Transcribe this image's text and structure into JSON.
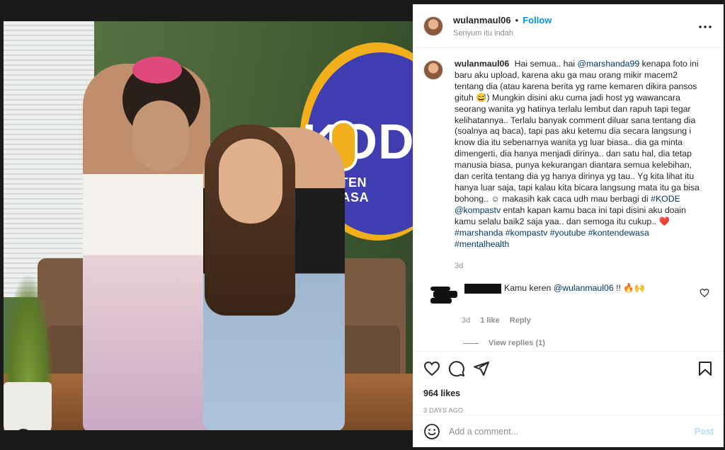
{
  "photo": {
    "logo_text": "KODE",
    "logo_subtext": "KONTEN DEWASA"
  },
  "header": {
    "username": "wulanmaul06",
    "separator": "•",
    "follow_label": "Follow",
    "location": "Senyum itu indah",
    "more_icon": "more-icon"
  },
  "caption": {
    "username": "wulanmaul06",
    "segments": [
      {
        "t": "text",
        "v": "Hai semua.. hai "
      },
      {
        "t": "mention",
        "v": "@marshanda99"
      },
      {
        "t": "text",
        "v": " kenapa foto ini baru aku upload, karena aku ga mau orang mikir macem2 tentang dia (atau karena berita yg rame kemaren dikira pansos gituh 😅) Mungkin disini aku cuma jadi host yg wawancara seorang wanita yg hatinya terlalu lembut dan rapuh tapi tegar kelihatannya.. Terlalu banyak comment diluar sana tentang dia (soalnya aq baca), tapi pas aku ketemu dia secara langsung i know dia itu sebenarnya wanita yg luar biasa.. dia ga minta dimengerti, dia hanya menjadi dirinya.. dan satu hal, dia tetap manusia biasa, punya kekurangan diantara semua kelebihan, dan cerita tentang dia yg hanya dirinya yg tau.. Yg kita lihat itu hanya luar saja, tapi kalau kita bicara langsung mata itu ga bisa bohong.. ☺ makasih kak caca udh mau berbagi di "
      },
      {
        "t": "tag",
        "v": "#KODE"
      },
      {
        "t": "text",
        "v": " "
      },
      {
        "t": "mention",
        "v": "@kompastv"
      },
      {
        "t": "text",
        "v": " entah kapan kamu baca ini tapi disini aku doain kamu selalu baik2 saja yaa.. dan semoga itu cukup.. ❤️ "
      },
      {
        "t": "tag",
        "v": "#marshanda"
      },
      {
        "t": "text",
        "v": " "
      },
      {
        "t": "tag",
        "v": "#kompastv"
      },
      {
        "t": "text",
        "v": " "
      },
      {
        "t": "tag",
        "v": "#youtube"
      },
      {
        "t": "text",
        "v": " "
      },
      {
        "t": "tag",
        "v": "#kontendewasa"
      },
      {
        "t": "text",
        "v": " "
      },
      {
        "t": "tag",
        "v": "#mentalhealth"
      }
    ],
    "time": "3d"
  },
  "comment": {
    "text_prefix": "Kamu keren ",
    "mention": "@wulanmaul06",
    "text_suffix": " !! 🔥🙌",
    "time": "3d",
    "likes": "1 like",
    "reply_label": "Reply",
    "view_replies": "View replies (1)"
  },
  "actions": {
    "icons": [
      "heart-icon",
      "comment-icon",
      "share-icon",
      "bookmark-icon"
    ],
    "likes": "964 likes",
    "posted": "3 DAYS AGO"
  },
  "add_comment": {
    "placeholder": "Add a comment...",
    "post_label": "Post"
  },
  "colors": {
    "accent": "#0095f6",
    "link": "#00376b",
    "muted": "#8e8e8e",
    "post_disabled": "#b2dffc"
  }
}
